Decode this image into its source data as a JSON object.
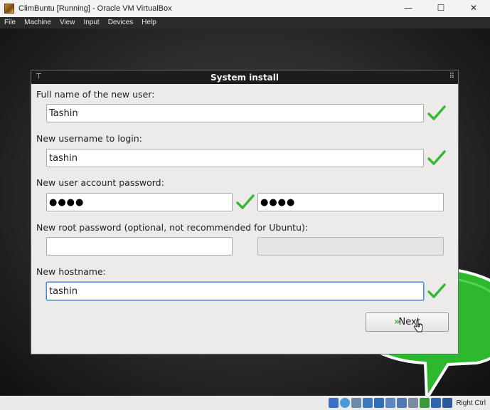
{
  "window": {
    "title": "ClimBuntu [Running] - Oracle VM VirtualBox",
    "minimize_glyph": "—",
    "maximize_glyph": "☐",
    "close_glyph": "✕"
  },
  "menu": [
    "File",
    "Machine",
    "View",
    "Input",
    "Devices",
    "Help"
  ],
  "dialog": {
    "title": "System install",
    "pin_glyph": "⊤",
    "grip_glyph": "⠿",
    "fields": {
      "full_name_label": "Full name of the new user:",
      "full_name_value": "Tashin",
      "username_label": "New username to login:",
      "username_value": "tashin",
      "password_label": "New user account password:",
      "password_value": "●●●●",
      "password_confirm_value": "●●●●",
      "root_password_label": "New root password (optional, not recommended for Ubuntu):",
      "root_password_value": "",
      "root_password_confirm_value": "",
      "hostname_label": "New hostname:",
      "hostname_value": "tashin"
    },
    "next_arrows": "»",
    "next_label": "Next"
  },
  "statusbar": {
    "host_key": "Right Ctrl"
  },
  "colors": {
    "check_green": "#35b835",
    "bubble_green": "#2db82d",
    "focus_blue": "#4a8ad6"
  }
}
